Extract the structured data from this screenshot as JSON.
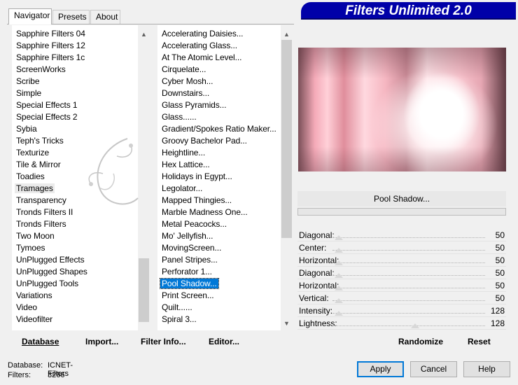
{
  "tabs": [
    "Navigator",
    "Presets",
    "About"
  ],
  "app_title": "Filters Unlimited 2.0",
  "categories": {
    "items": [
      "Sapphire Filters 04",
      "Sapphire Filters 12",
      "Sapphire Filters 1c",
      "ScreenWorks",
      "Scribe",
      "Simple",
      "Special Effects 1",
      "Special Effects 2",
      "Sybia",
      "Teph's Tricks",
      "Texturize",
      "Tile & Mirror",
      "Toadies",
      "Tramages",
      "Transparency",
      "Tronds Filters II",
      "Tronds Filters",
      "Two Moon",
      "Tymoes",
      "UnPlugged Effects",
      "UnPlugged Shapes",
      "UnPlugged Tools",
      "Variations",
      "Video",
      "Videofilter"
    ],
    "selected": "Tramages"
  },
  "filters": {
    "items": [
      "Accelerating Daisies...",
      "Accelerating Glass...",
      "At The Atomic Level...",
      "Cirquelate...",
      "Cyber Mosh...",
      "Downstairs...",
      "Glass Pyramids...",
      "Glass......",
      "Gradient/Spokes Ratio Maker...",
      "Groovy Bachelor Pad...",
      "Heightline...",
      "Hex Lattice...",
      "Holidays in Egypt...",
      "Legolator...",
      "Mapped Thingies...",
      "Marble Madness One...",
      "Metal Peacocks...",
      "Mo' Jellyfish...",
      "MovingScreen...",
      "Panel Stripes...",
      "Perforator 1...",
      "Pool Shadow...",
      "Print Screen...",
      "Quilt......",
      "Spiral 3..."
    ],
    "selected": "Pool Shadow..."
  },
  "filter_name": "Pool Shadow...",
  "params": [
    {
      "label": "Diagonal:",
      "value": "50",
      "level": 0.0
    },
    {
      "label": "Center:",
      "value": "50",
      "level": 0.0
    },
    {
      "label": "Horizontal:",
      "value": "50",
      "level": 0.0
    },
    {
      "label": "Diagonal:",
      "value": "50",
      "level": 0.0
    },
    {
      "label": "Horizontal:",
      "value": "50",
      "level": 0.0
    },
    {
      "label": "Vertical:",
      "value": "50",
      "level": 0.0
    },
    {
      "label": "Intensity:",
      "value": "128",
      "level": 0.0
    },
    {
      "label": "Lightness:",
      "value": "128",
      "level": 0.5
    }
  ],
  "actions": {
    "database": "Database",
    "import": "Import...",
    "filter_info": "Filter Info...",
    "editor": "Editor...",
    "randomize": "Randomize",
    "reset": "Reset"
  },
  "status": {
    "database_label": "Database:",
    "database_value": "ICNET-Filters",
    "filters_label": "Filters:",
    "filters_value": "3266"
  },
  "buttons": {
    "apply": "Apply",
    "cancel": "Cancel",
    "help": "Help"
  },
  "colors": {
    "banner": "#0000a8",
    "selection": "#0078d7"
  }
}
